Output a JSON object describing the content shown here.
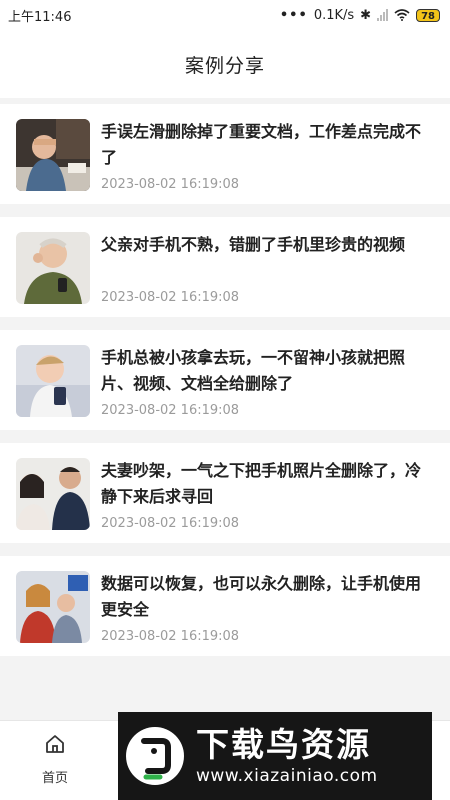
{
  "status_bar": {
    "time": "上午11:46",
    "network_speed": "0.1K/s",
    "battery": "78"
  },
  "header": {
    "title": "案例分享"
  },
  "cases": [
    {
      "title": "手误左滑删除掉了重要文档，工作差点完成不了",
      "time": "2023-08-02 16:19:08",
      "thumb": "stressed-worker-thumbnail"
    },
    {
      "title": "父亲对手机不熟，错删了手机里珍贵的视频",
      "time": "2023-08-02 16:19:08",
      "thumb": "elderly-man-phone-thumbnail"
    },
    {
      "title": "手机总被小孩拿去玩，一不留神小孩就把照片、视频、文档全给删除了",
      "time": "2023-08-02 16:19:08",
      "thumb": "child-phone-thumbnail"
    },
    {
      "title": "夫妻吵架，一气之下把手机照片全删除了，冷静下来后求寻回",
      "time": "2023-08-02 16:19:08",
      "thumb": "couple-argument-thumbnail"
    },
    {
      "title": "数据可以恢复，也可以永久删除，让手机使用更安全",
      "time": "2023-08-02 16:19:08",
      "thumb": "office-group-thumbnail"
    }
  ],
  "tabbar": {
    "home_label": "首页"
  },
  "watermark": {
    "name": "下载鸟资源",
    "url": "www.xiazainiao.com"
  },
  "colors": {
    "background": "#f3f3f3",
    "card": "#ffffff",
    "timestamp": "#9b9b9b",
    "battery": "#f3c419",
    "watermark_bg": "#161616"
  }
}
